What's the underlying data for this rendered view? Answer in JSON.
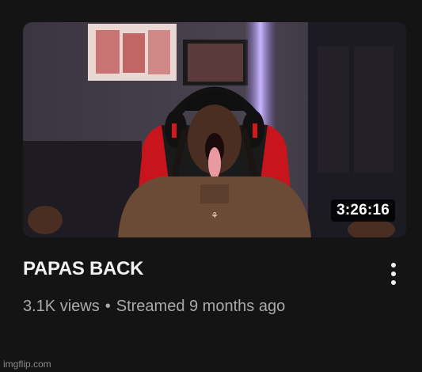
{
  "video": {
    "duration": "3:26:16",
    "title": "PAPAS BACK",
    "views": "3.1K views",
    "separator": "•",
    "streamed": "Streamed 9 months ago"
  },
  "menu": {
    "icon": "more-vert-icon"
  },
  "watermark": "imgflip.com"
}
